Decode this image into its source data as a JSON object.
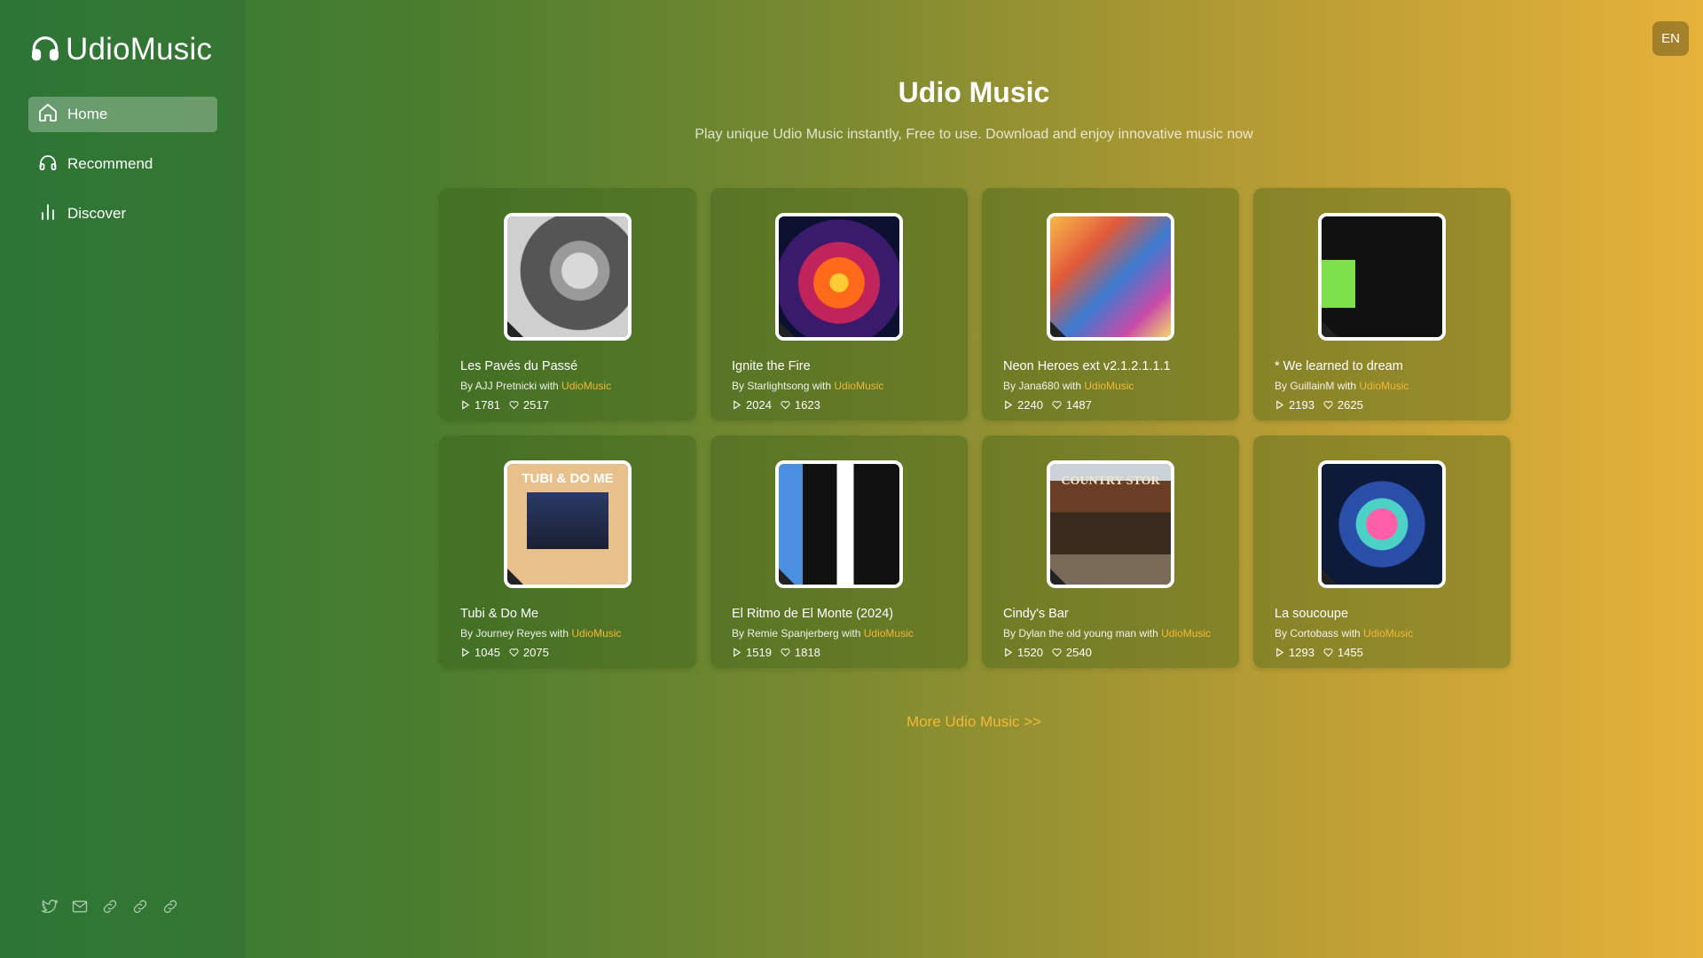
{
  "app": {
    "logo_text": "UdioMusic"
  },
  "nav": {
    "items": [
      {
        "label": "Home",
        "icon": "home-icon",
        "active": true
      },
      {
        "label": "Recommend",
        "icon": "headphones-icon",
        "active": false
      },
      {
        "label": "Discover",
        "icon": "bar-chart-icon",
        "active": false
      }
    ]
  },
  "lang": "EN",
  "header": {
    "title": "Udio Music",
    "subtitle": "Play unique Udio Music instantly, Free to use. Download and enjoy innovative music now"
  },
  "cards": [
    {
      "title": "Les Pavés du Passé",
      "by_prefix": "By AJJ Pretnicki with ",
      "brand": "UdioMusic",
      "plays": "1781",
      "likes": "2517"
    },
    {
      "title": "Ignite the Fire",
      "by_prefix": "By Starlightsong with ",
      "brand": "UdioMusic",
      "plays": "2024",
      "likes": "1623"
    },
    {
      "title": "Neon Heroes ext v2.1.2.1.1.1",
      "by_prefix": "By Jana680 with ",
      "brand": "UdioMusic",
      "plays": "2240",
      "likes": "1487"
    },
    {
      "title": "* We learned to dream",
      "by_prefix": "By GuillainM with ",
      "brand": "UdioMusic",
      "plays": "2193",
      "likes": "2625"
    },
    {
      "title": "Tubi & Do Me",
      "by_prefix": "By Journey Reyes with ",
      "brand": "UdioMusic",
      "plays": "1045",
      "likes": "2075",
      "cover_text": "TUBI & DO ME"
    },
    {
      "title": "El Ritmo de El Monte (2024)",
      "by_prefix": "By Remie Spanjerberg with ",
      "brand": "UdioMusic",
      "plays": "1519",
      "likes": "1818"
    },
    {
      "title": "Cindy's Bar",
      "by_prefix": "By Dylan the old young man with ",
      "brand": "UdioMusic",
      "plays": "1520",
      "likes": "2540",
      "cover_text": "COUNTRY STOR"
    },
    {
      "title": "La soucoupe",
      "by_prefix": "By Cortobass with ",
      "brand": "UdioMusic",
      "plays": "1293",
      "likes": "1455"
    }
  ],
  "more_link": "More Udio Music >>",
  "social": [
    "twitter-icon",
    "mail-icon",
    "link-icon",
    "link-icon",
    "link-icon"
  ],
  "colors": {
    "accent": "#f3b836"
  }
}
